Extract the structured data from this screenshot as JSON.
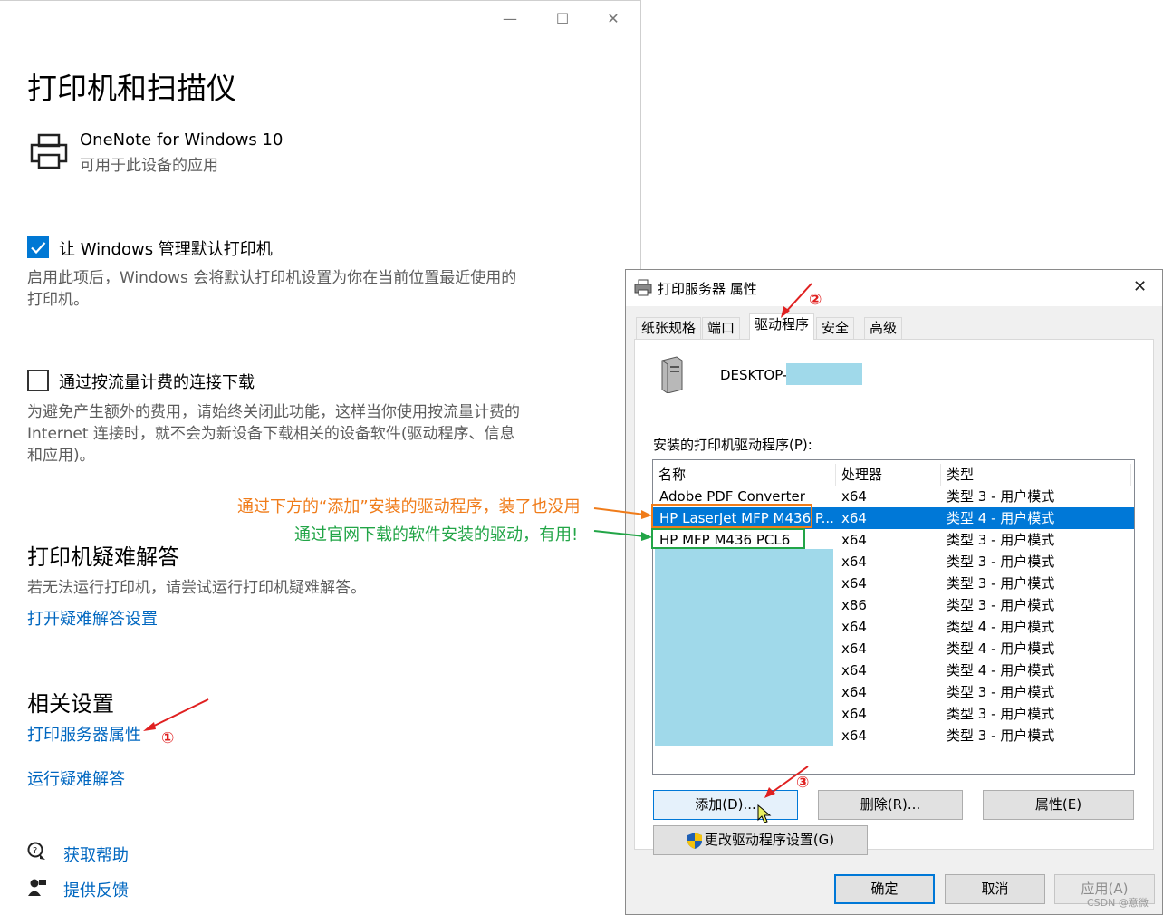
{
  "settings": {
    "title": "打印机和扫描仪",
    "app": {
      "name": "OneNote for Windows 10",
      "subtitle": "可用于此设备的应用"
    },
    "default_printer": {
      "label": "让 Windows 管理默认打印机",
      "checked": true,
      "desc_line1": "启用此项后，Windows 会将默认打印机设置为你在当前位置最近使用的",
      "desc_line2": "打印机。"
    },
    "metered": {
      "label": "通过按流量计费的连接下载",
      "checked": false,
      "desc_line1": "为避免产生额外的费用，请始终关闭此功能，这样当你使用按流量计费的",
      "desc_line2": "Internet 连接时，就不会为新设备下载相关的设备软件(驱动程序、信息",
      "desc_line3": "和应用)。"
    },
    "troubleshoot": {
      "heading": "打印机疑难解答",
      "desc": "若无法运行打印机，请尝试运行打印机疑难解答。",
      "link": "打开疑难解答设置"
    },
    "related": {
      "heading": "相关设置",
      "print_server_link": "打印服务器属性",
      "run_troubleshooter_link": "运行疑难解答"
    },
    "help": {
      "get_help": "获取帮助",
      "feedback": "提供反馈"
    }
  },
  "dialog": {
    "title": "打印服务器 属性",
    "tabs": [
      "纸张规格",
      "端口",
      "驱动程序",
      "安全",
      "高级"
    ],
    "active_tab": "驱动程序",
    "computer_name": "DESKTOP-",
    "list_label": "安装的打印机驱动程序(P):",
    "columns": {
      "name": "名称",
      "processor": "处理器",
      "type": "类型"
    },
    "rows": [
      {
        "name": "Adobe PDF Converter",
        "processor": "x64",
        "type": "类型 3 - 用户模式"
      },
      {
        "name": "HP LaserJet MFP M436 P...",
        "processor": "x64",
        "type": "类型 4 - 用户模式"
      },
      {
        "name": "HP MFP M436 PCL6",
        "processor": "x64",
        "type": "类型 3 - 用户模式"
      },
      {
        "name": "",
        "processor": "x64",
        "type": "类型 3 - 用户模式"
      },
      {
        "name": "",
        "processor": "x64",
        "type": "类型 3 - 用户模式"
      },
      {
        "name": "",
        "processor": "x86",
        "type": "类型 3 - 用户模式"
      },
      {
        "name": "",
        "processor": "x64",
        "type": "类型 4 - 用户模式"
      },
      {
        "name": "",
        "processor": "x64",
        "type": "类型 4 - 用户模式"
      },
      {
        "name": "",
        "processor": "x64",
        "type": "类型 4 - 用户模式"
      },
      {
        "name": "",
        "processor": "x64",
        "type": "类型 3 - 用户模式"
      },
      {
        "name": "",
        "processor": "x64",
        "type": "类型 3 - 用户模式"
      },
      {
        "name": "",
        "processor": "x64",
        "type": "类型 3 - 用户模式"
      }
    ],
    "selected_row": 1,
    "buttons": {
      "add": "添加(D)...",
      "remove": "删除(R)...",
      "properties": "属性(E)",
      "change_settings": "更改驱动程序设置(G)",
      "ok": "确定",
      "cancel": "取消",
      "apply": "应用(A)"
    }
  },
  "annotations": {
    "orange_note": "通过下方的“添加”安装的驱动程序，装了也没用",
    "green_note": "通过官网下载的软件安装的驱动，有用!",
    "step1": "①",
    "step2": "②",
    "step3": "③"
  },
  "watermark": "CSDN @意微",
  "colors": {
    "accent": "#0078d4",
    "link": "#0067c0",
    "orange": "#f07c1a",
    "green": "#22a547",
    "red": "#e02020"
  }
}
